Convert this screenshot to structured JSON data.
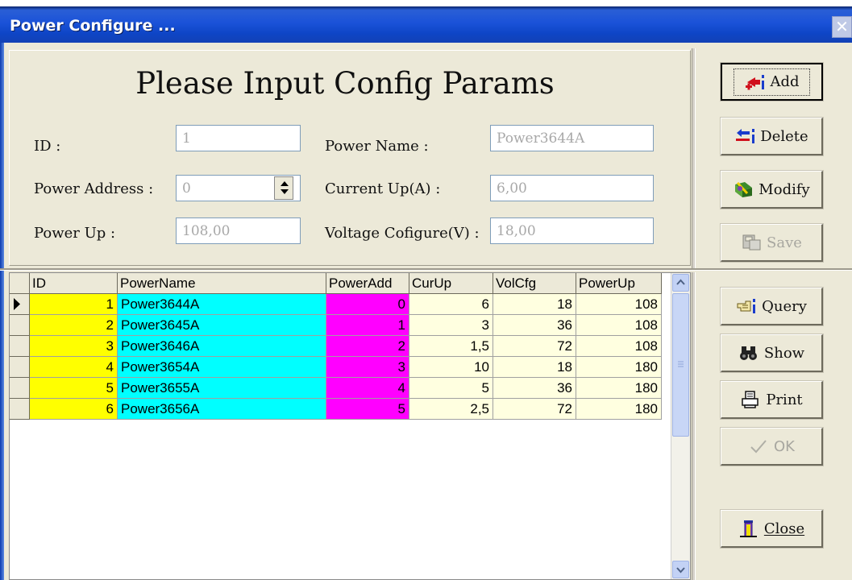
{
  "window": {
    "title": "Power Configure ...",
    "close_glyph": "✕"
  },
  "form": {
    "heading": "Please Input Config Params",
    "id_label": "ID :",
    "id_value": "1",
    "power_name_label": "Power Name :",
    "power_name_value": "Power3644A",
    "power_address_label": "Power Address :",
    "power_address_value": "0",
    "current_up_label": "Current Up(A) :",
    "current_up_value": "6,00",
    "power_up_label": "Power Up :",
    "power_up_value": "108,00",
    "voltage_label": "Voltage Cofigure(V) :",
    "voltage_value": "18,00"
  },
  "buttons": {
    "add": "Add",
    "delete": "Delete",
    "modify": "Modify",
    "save": "Save",
    "query": "Query",
    "show": "Show",
    "print": "Print",
    "ok": "OK",
    "close": "Close"
  },
  "grid": {
    "columns": [
      "ID",
      "PowerName",
      "PowerAdd",
      "CurUp",
      "VolCfg",
      "PowerUp"
    ],
    "rows": [
      [
        "1",
        "Power3644A",
        "0",
        "6",
        "18",
        "108"
      ],
      [
        "2",
        "Power3645A",
        "1",
        "3",
        "36",
        "108"
      ],
      [
        "3",
        "Power3646A",
        "2",
        "1,5",
        "72",
        "108"
      ],
      [
        "4",
        "Power3654A",
        "3",
        "10",
        "18",
        "180"
      ],
      [
        "5",
        "Power3655A",
        "4",
        "5",
        "36",
        "180"
      ],
      [
        "6",
        "Power3656A",
        "5",
        "2,5",
        "72",
        "180"
      ]
    ],
    "column_colors": [
      "#ffff00",
      "#00ffff",
      "#ff00ff",
      "#ffffe0",
      "#ffffe0",
      "#ffffe0"
    ],
    "selected_row": 0
  }
}
